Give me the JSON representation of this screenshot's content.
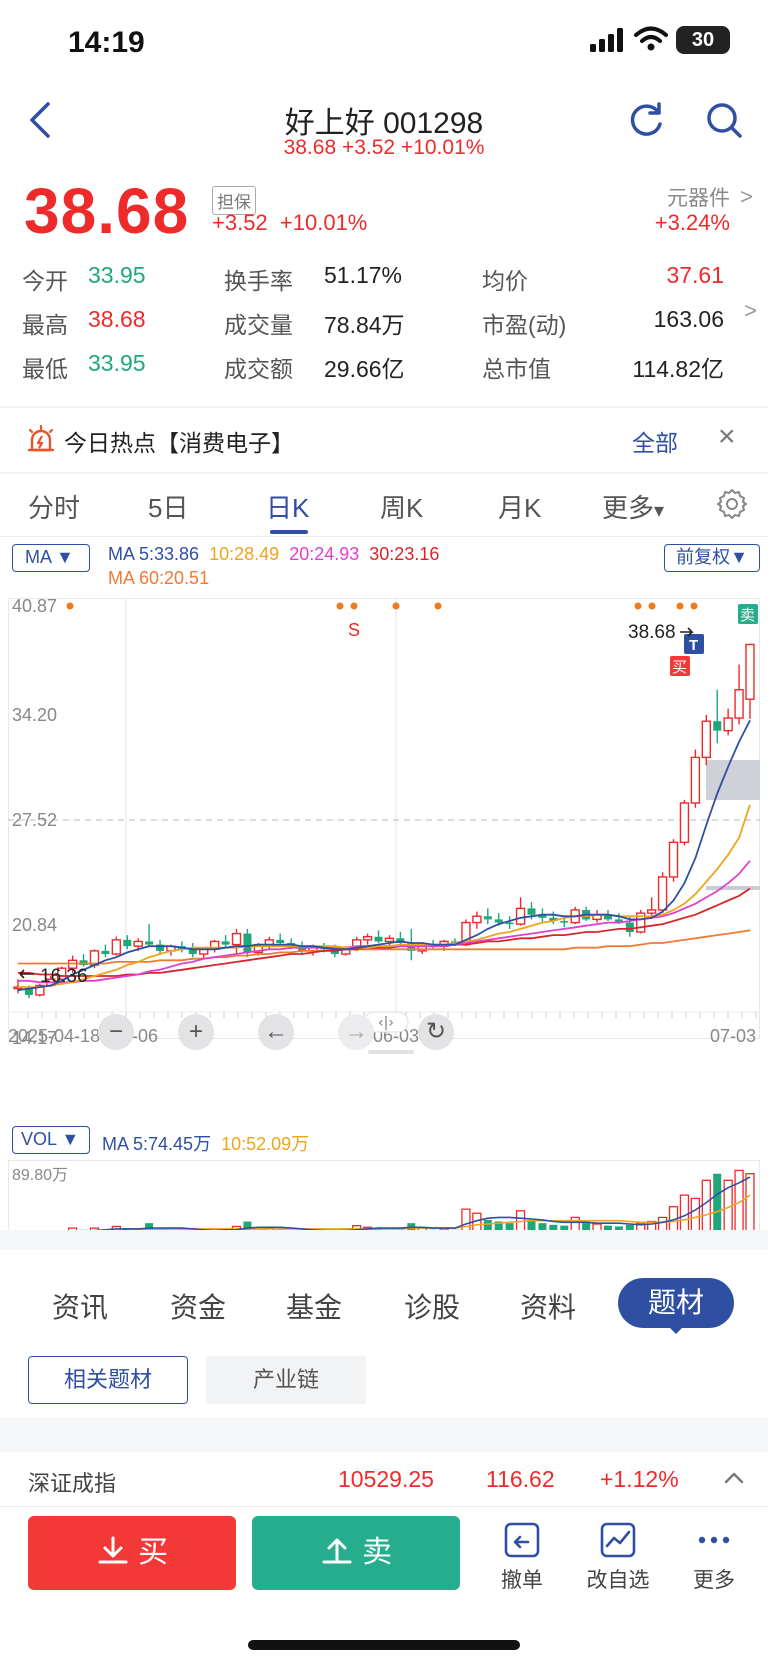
{
  "status_bar": {
    "time": "14:19",
    "battery": "30"
  },
  "header": {
    "title": "好上好 001298",
    "subtitle": "38.68 +3.52 +10.01%"
  },
  "price": {
    "last": "38.68",
    "badge": "担保",
    "change": "+3.52",
    "change_pct": "+10.01%",
    "sector_name": "元器件",
    "sector_pct": "+3.24%",
    "arrow": ">"
  },
  "quote": [
    [
      {
        "label": "今开",
        "value": "33.95",
        "color": "green"
      },
      {
        "label": "换手率",
        "value": "51.17%",
        "color": "black"
      },
      {
        "label": "均价",
        "value": "37.61",
        "color": "red"
      }
    ],
    [
      {
        "label": "最高",
        "value": "38.68",
        "color": "red"
      },
      {
        "label": "成交量",
        "value": "78.84万",
        "color": "black"
      },
      {
        "label": "市盈(动)",
        "value": "163.06",
        "color": "black"
      }
    ],
    [
      {
        "label": "最低",
        "value": "33.95",
        "color": "green"
      },
      {
        "label": "成交额",
        "value": "29.66亿",
        "color": "black"
      },
      {
        "label": "总市值",
        "value": "114.82亿",
        "color": "black"
      }
    ]
  ],
  "hot": {
    "text": "今日热点【消费电子】",
    "all": "全部",
    "close": "×"
  },
  "ktabs": [
    {
      "label": "分时",
      "active": false
    },
    {
      "label": "5日",
      "active": false
    },
    {
      "label": "日K",
      "active": true
    },
    {
      "label": "周K",
      "active": false
    },
    {
      "label": "月K",
      "active": false
    },
    {
      "label": "更多",
      "active": false
    }
  ],
  "ma_legend": {
    "button": "MA",
    "ma5": "MA 5:33.86",
    "ma10": "10:28.49",
    "ma20": "20:24.93",
    "ma30": "30:23.16",
    "ma60": "MA 60:20.51",
    "fq": "前复权"
  },
  "kline": {
    "y_ticks": [
      "40.87",
      "34.20",
      "27.52",
      "20.84",
      "14.17"
    ],
    "x_ticks": [
      "2025-04-18",
      "5-06",
      "06-03",
      "07-03"
    ],
    "last_label": "38.68",
    "low_label": "16.36",
    "markers": {
      "s": "S",
      "buy": "买",
      "sell": "卖",
      "t": "T"
    },
    "nav_buttons": [
      "−",
      "+",
      "←",
      "→",
      "↻"
    ],
    "drag_handle": "‹|›"
  },
  "chart_data": {
    "type": "candlestick",
    "ylim": [
      14.17,
      40.87
    ],
    "x_labels": [
      "2025-04-18",
      "5-06",
      "06-03",
      "07-03"
    ],
    "candles": [
      [
        16.8,
        17.4,
        16.5,
        16.9
      ],
      [
        16.9,
        17.0,
        16.2,
        16.4
      ],
      [
        16.4,
        17.1,
        16.3,
        17.0
      ],
      [
        17.0,
        17.6,
        16.9,
        17.4
      ],
      [
        17.4,
        18.2,
        17.3,
        18.1
      ],
      [
        18.1,
        18.9,
        17.8,
        18.6
      ],
      [
        18.6,
        19.0,
        18.2,
        18.3
      ],
      [
        18.3,
        19.3,
        18.1,
        19.2
      ],
      [
        19.2,
        19.6,
        18.8,
        19.0
      ],
      [
        19.0,
        20.1,
        18.9,
        19.9
      ],
      [
        19.9,
        20.2,
        19.3,
        19.5
      ],
      [
        19.5,
        20.0,
        19.2,
        19.8
      ],
      [
        19.8,
        20.9,
        19.5,
        19.6
      ],
      [
        19.6,
        19.9,
        19.0,
        19.2
      ],
      [
        19.2,
        19.6,
        18.9,
        19.5
      ],
      [
        19.5,
        19.8,
        19.1,
        19.3
      ],
      [
        19.3,
        19.7,
        18.8,
        19.0
      ],
      [
        19.0,
        19.4,
        18.7,
        19.3
      ],
      [
        19.3,
        19.9,
        19.1,
        19.8
      ],
      [
        19.8,
        20.2,
        19.4,
        19.6
      ],
      [
        19.6,
        20.6,
        19.0,
        20.3
      ],
      [
        20.3,
        20.6,
        18.8,
        19.1
      ],
      [
        19.1,
        19.7,
        18.9,
        19.6
      ],
      [
        19.6,
        20.1,
        19.3,
        19.9
      ],
      [
        19.9,
        20.3,
        19.5,
        19.7
      ],
      [
        19.7,
        20.0,
        19.3,
        19.5
      ],
      [
        19.5,
        19.8,
        19.0,
        19.2
      ],
      [
        19.2,
        19.6,
        18.9,
        19.5
      ],
      [
        19.5,
        19.7,
        19.1,
        19.3
      ],
      [
        19.3,
        19.6,
        18.8,
        19.0
      ],
      [
        19.0,
        19.5,
        18.9,
        19.4
      ],
      [
        19.4,
        20.1,
        19.2,
        19.9
      ],
      [
        19.9,
        20.3,
        19.6,
        20.1
      ],
      [
        20.1,
        20.5,
        19.7,
        19.8
      ],
      [
        19.8,
        20.2,
        19.4,
        20.0
      ],
      [
        20.0,
        20.4,
        19.6,
        19.7
      ],
      [
        19.7,
        20.6,
        18.6,
        19.2
      ],
      [
        19.2,
        19.7,
        19.0,
        19.6
      ],
      [
        19.6,
        19.9,
        19.3,
        19.5
      ],
      [
        19.5,
        19.9,
        19.2,
        19.8
      ],
      [
        19.8,
        20.0,
        19.5,
        19.6
      ],
      [
        19.6,
        21.2,
        19.5,
        21.0
      ],
      [
        21.0,
        21.7,
        20.6,
        21.4
      ],
      [
        21.4,
        21.9,
        20.9,
        21.2
      ],
      [
        21.2,
        21.6,
        20.8,
        21.0
      ],
      [
        21.0,
        21.4,
        20.6,
        20.9
      ],
      [
        20.9,
        22.6,
        20.8,
        21.9
      ],
      [
        21.9,
        22.3,
        21.2,
        21.5
      ],
      [
        21.5,
        21.9,
        21.0,
        21.3
      ],
      [
        21.3,
        21.7,
        20.9,
        21.1
      ],
      [
        21.1,
        21.4,
        20.7,
        21.0
      ],
      [
        21.0,
        22.0,
        20.9,
        21.8
      ],
      [
        21.8,
        22.0,
        21.1,
        21.2
      ],
      [
        21.2,
        21.8,
        21.0,
        21.5
      ],
      [
        21.5,
        21.8,
        21.1,
        21.2
      ],
      [
        21.2,
        21.6,
        20.9,
        21.0
      ],
      [
        21.0,
        21.4,
        20.1,
        20.4
      ],
      [
        20.4,
        21.8,
        20.3,
        21.6
      ],
      [
        21.6,
        22.6,
        21.3,
        21.8
      ],
      [
        21.8,
        24.2,
        21.6,
        23.9
      ],
      [
        23.9,
        26.3,
        23.6,
        26.1
      ],
      [
        26.1,
        28.8,
        25.9,
        28.6
      ],
      [
        28.6,
        32.0,
        28.3,
        31.5
      ],
      [
        31.5,
        34.2,
        31.0,
        33.8
      ],
      [
        33.8,
        35.8,
        32.4,
        33.2
      ],
      [
        33.2,
        34.6,
        32.9,
        34.0
      ],
      [
        34.0,
        37.4,
        33.6,
        35.8
      ],
      [
        35.2,
        38.68,
        33.95,
        38.68
      ]
    ],
    "ma5": [
      16.7,
      16.8,
      16.9,
      17.0,
      17.3,
      17.7,
      18.0,
      18.3,
      18.6,
      18.8,
      19.1,
      19.3,
      19.5,
      19.5,
      19.5,
      19.4,
      19.3,
      19.3,
      19.3,
      19.4,
      19.5,
      19.5,
      19.6,
      19.6,
      19.6,
      19.6,
      19.5,
      19.5,
      19.4,
      19.3,
      19.3,
      19.4,
      19.5,
      19.6,
      19.7,
      19.8,
      19.7,
      19.7,
      19.6,
      19.6,
      19.6,
      19.9,
      20.2,
      20.6,
      20.9,
      21.1,
      21.3,
      21.4,
      21.5,
      21.5,
      21.4,
      21.4,
      21.5,
      21.5,
      21.5,
      21.4,
      21.2,
      21.2,
      21.3,
      21.7,
      22.4,
      23.5,
      25.1,
      27.2,
      29.2,
      30.9,
      32.5,
      33.86
    ],
    "ma10": [
      16.9,
      16.9,
      16.9,
      17.0,
      17.1,
      17.2,
      17.4,
      17.6,
      17.8,
      18.0,
      18.3,
      18.5,
      18.8,
      19.0,
      19.2,
      19.3,
      19.4,
      19.4,
      19.4,
      19.4,
      19.4,
      19.5,
      19.5,
      19.5,
      19.5,
      19.5,
      19.5,
      19.5,
      19.5,
      19.5,
      19.4,
      19.4,
      19.4,
      19.5,
      19.5,
      19.6,
      19.6,
      19.6,
      19.6,
      19.6,
      19.7,
      19.8,
      19.9,
      20.1,
      20.3,
      20.4,
      20.6,
      20.8,
      21.0,
      21.1,
      21.3,
      21.4,
      21.4,
      21.5,
      21.5,
      21.4,
      21.4,
      21.4,
      21.4,
      21.5,
      21.8,
      22.2,
      22.8,
      23.6,
      24.4,
      25.3,
      26.4,
      28.49
    ],
    "ma20": [
      17.3,
      17.3,
      17.2,
      17.2,
      17.2,
      17.2,
      17.3,
      17.3,
      17.4,
      17.5,
      17.6,
      17.7,
      17.9,
      18.0,
      18.2,
      18.4,
      18.5,
      18.7,
      18.8,
      18.9,
      19.0,
      19.1,
      19.2,
      19.3,
      19.3,
      19.4,
      19.4,
      19.4,
      19.4,
      19.4,
      19.4,
      19.5,
      19.5,
      19.5,
      19.5,
      19.5,
      19.5,
      19.5,
      19.5,
      19.5,
      19.6,
      19.7,
      19.8,
      19.9,
      20.0,
      20.1,
      20.2,
      20.3,
      20.4,
      20.5,
      20.6,
      20.7,
      20.8,
      20.9,
      21.0,
      21.0,
      21.1,
      21.2,
      21.3,
      21.4,
      21.6,
      21.9,
      22.2,
      22.6,
      23.0,
      23.5,
      24.1,
      24.93
    ],
    "ma30": [
      17.8,
      17.8,
      17.7,
      17.7,
      17.6,
      17.6,
      17.6,
      17.6,
      17.6,
      17.6,
      17.7,
      17.7,
      17.8,
      17.8,
      17.9,
      18.0,
      18.1,
      18.2,
      18.3,
      18.4,
      18.5,
      18.6,
      18.7,
      18.8,
      18.9,
      19.0,
      19.0,
      19.1,
      19.2,
      19.2,
      19.3,
      19.3,
      19.4,
      19.4,
      19.4,
      19.5,
      19.5,
      19.5,
      19.5,
      19.5,
      19.6,
      19.6,
      19.7,
      19.8,
      19.8,
      19.9,
      20.0,
      20.0,
      20.1,
      20.2,
      20.2,
      20.3,
      20.4,
      20.4,
      20.5,
      20.6,
      20.6,
      20.7,
      20.8,
      20.9,
      21.1,
      21.3,
      21.5,
      21.8,
      22.1,
      22.4,
      22.7,
      23.16
    ],
    "ma60": [
      18.4,
      18.4,
      18.4,
      18.4,
      18.4,
      18.4,
      18.4,
      18.4,
      18.4,
      18.5,
      18.5,
      18.5,
      18.5,
      18.6,
      18.6,
      18.6,
      18.7,
      18.7,
      18.8,
      18.8,
      18.9,
      18.9,
      19.0,
      19.0,
      19.1,
      19.1,
      19.2,
      19.2,
      19.2,
      19.3,
      19.3,
      19.3,
      19.3,
      19.3,
      19.3,
      19.3,
      19.3,
      19.3,
      19.3,
      19.3,
      19.3,
      19.3,
      19.3,
      19.3,
      19.3,
      19.3,
      19.3,
      19.3,
      19.3,
      19.3,
      19.3,
      19.4,
      19.4,
      19.4,
      19.5,
      19.5,
      19.5,
      19.6,
      19.7,
      19.7,
      19.8,
      19.9,
      20.0,
      20.1,
      20.2,
      20.3,
      20.4,
      20.51
    ]
  },
  "volume": {
    "button": "VOL",
    "ma5": "MA 5:74.45万",
    "ma10": "10:52.09万",
    "ymax_label": "89.80万",
    "ymax": 89.8,
    "bars": [
      4,
      5,
      4,
      6,
      8,
      12,
      10,
      12,
      9,
      14,
      12,
      11,
      18,
      10,
      9,
      10,
      8,
      9,
      11,
      10,
      14,
      20,
      11,
      12,
      10,
      9,
      8,
      9,
      10,
      9,
      11,
      15,
      13,
      12,
      11,
      10,
      18,
      12,
      10,
      11,
      10,
      35,
      30,
      22,
      20,
      18,
      33,
      22,
      18,
      16,
      15,
      25,
      18,
      17,
      15,
      14,
      16,
      18,
      20,
      25,
      38,
      52,
      48,
      70,
      78,
      70,
      82,
      78
    ],
    "vma5": [
      5,
      5,
      5,
      5,
      6,
      7,
      8,
      9,
      10,
      11,
      11,
      11,
      12,
      12,
      12,
      12,
      11,
      10,
      9,
      10,
      10,
      12,
      13,
      13,
      13,
      12,
      11,
      10,
      9,
      9,
      9,
      10,
      11,
      12,
      12,
      12,
      13,
      13,
      12,
      12,
      12,
      17,
      21,
      24,
      25,
      25,
      24,
      23,
      22,
      20,
      19,
      19,
      19,
      18,
      18,
      18,
      17,
      16,
      17,
      19,
      22,
      27,
      34,
      43,
      53,
      61,
      67,
      74
    ],
    "vma10": [
      6,
      6,
      6,
      6,
      6,
      7,
      7,
      7,
      8,
      8,
      9,
      9,
      10,
      10,
      11,
      11,
      11,
      11,
      11,
      11,
      11,
      11,
      11,
      11,
      11,
      11,
      11,
      11,
      11,
      11,
      11,
      11,
      11,
      11,
      11,
      11,
      12,
      12,
      12,
      12,
      12,
      14,
      16,
      17,
      18,
      19,
      20,
      21,
      21,
      21,
      21,
      21,
      21,
      21,
      21,
      21,
      20,
      19,
      19,
      19,
      20,
      22,
      25,
      28,
      32,
      37,
      43,
      52
    ]
  },
  "bottom_tabs": [
    "资讯",
    "资金",
    "基金",
    "诊股",
    "资料",
    "题材"
  ],
  "bottom_tab_active": "题材",
  "sub_tabs": [
    "相关题材",
    "产业链"
  ],
  "index_bar": {
    "name": "深证成指",
    "value": "10529.25",
    "change": "116.62",
    "pct": "+1.12%"
  },
  "actions": {
    "buy": "买",
    "sell": "卖",
    "cancel": "撤单",
    "edit_watch": "改自选",
    "more": "更多"
  },
  "colors": {
    "up": "#ee2a2a",
    "down": "#1fa67a",
    "accent": "#2f4fa2",
    "ma5": "#2f4fa2",
    "ma10": "#f0a31c",
    "ma20": "#e040d0",
    "ma30": "#d6262b",
    "ma60": "#f07a36"
  }
}
